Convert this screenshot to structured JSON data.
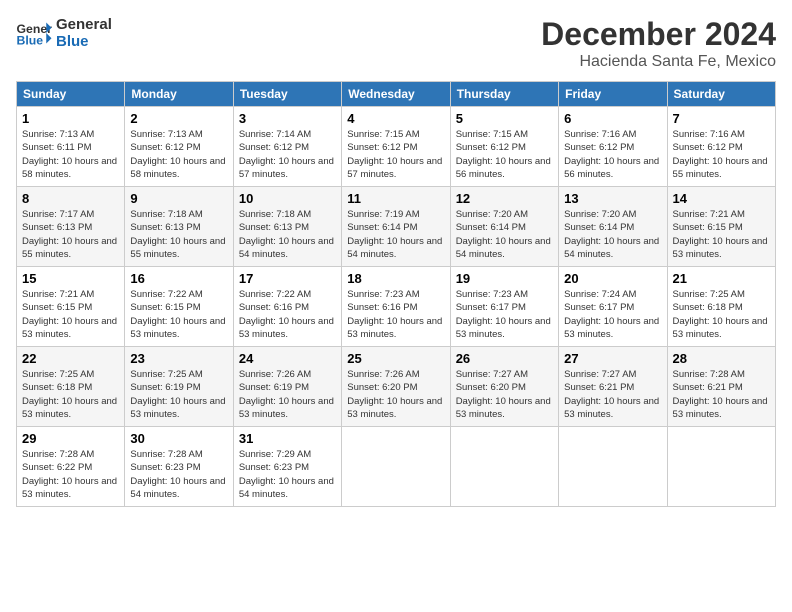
{
  "logo": {
    "line1": "General",
    "line2": "Blue"
  },
  "title": "December 2024",
  "location": "Hacienda Santa Fe, Mexico",
  "days_of_week": [
    "Sunday",
    "Monday",
    "Tuesday",
    "Wednesday",
    "Thursday",
    "Friday",
    "Saturday"
  ],
  "weeks": [
    [
      {
        "day": "1",
        "sunrise": "7:13 AM",
        "sunset": "6:11 PM",
        "daylight": "10 hours and 58 minutes."
      },
      {
        "day": "2",
        "sunrise": "7:13 AM",
        "sunset": "6:12 PM",
        "daylight": "10 hours and 58 minutes."
      },
      {
        "day": "3",
        "sunrise": "7:14 AM",
        "sunset": "6:12 PM",
        "daylight": "10 hours and 57 minutes."
      },
      {
        "day": "4",
        "sunrise": "7:15 AM",
        "sunset": "6:12 PM",
        "daylight": "10 hours and 57 minutes."
      },
      {
        "day": "5",
        "sunrise": "7:15 AM",
        "sunset": "6:12 PM",
        "daylight": "10 hours and 56 minutes."
      },
      {
        "day": "6",
        "sunrise": "7:16 AM",
        "sunset": "6:12 PM",
        "daylight": "10 hours and 56 minutes."
      },
      {
        "day": "7",
        "sunrise": "7:16 AM",
        "sunset": "6:12 PM",
        "daylight": "10 hours and 55 minutes."
      }
    ],
    [
      {
        "day": "8",
        "sunrise": "7:17 AM",
        "sunset": "6:13 PM",
        "daylight": "10 hours and 55 minutes."
      },
      {
        "day": "9",
        "sunrise": "7:18 AM",
        "sunset": "6:13 PM",
        "daylight": "10 hours and 55 minutes."
      },
      {
        "day": "10",
        "sunrise": "7:18 AM",
        "sunset": "6:13 PM",
        "daylight": "10 hours and 54 minutes."
      },
      {
        "day": "11",
        "sunrise": "7:19 AM",
        "sunset": "6:14 PM",
        "daylight": "10 hours and 54 minutes."
      },
      {
        "day": "12",
        "sunrise": "7:20 AM",
        "sunset": "6:14 PM",
        "daylight": "10 hours and 54 minutes."
      },
      {
        "day": "13",
        "sunrise": "7:20 AM",
        "sunset": "6:14 PM",
        "daylight": "10 hours and 54 minutes."
      },
      {
        "day": "14",
        "sunrise": "7:21 AM",
        "sunset": "6:15 PM",
        "daylight": "10 hours and 53 minutes."
      }
    ],
    [
      {
        "day": "15",
        "sunrise": "7:21 AM",
        "sunset": "6:15 PM",
        "daylight": "10 hours and 53 minutes."
      },
      {
        "day": "16",
        "sunrise": "7:22 AM",
        "sunset": "6:15 PM",
        "daylight": "10 hours and 53 minutes."
      },
      {
        "day": "17",
        "sunrise": "7:22 AM",
        "sunset": "6:16 PM",
        "daylight": "10 hours and 53 minutes."
      },
      {
        "day": "18",
        "sunrise": "7:23 AM",
        "sunset": "6:16 PM",
        "daylight": "10 hours and 53 minutes."
      },
      {
        "day": "19",
        "sunrise": "7:23 AM",
        "sunset": "6:17 PM",
        "daylight": "10 hours and 53 minutes."
      },
      {
        "day": "20",
        "sunrise": "7:24 AM",
        "sunset": "6:17 PM",
        "daylight": "10 hours and 53 minutes."
      },
      {
        "day": "21",
        "sunrise": "7:25 AM",
        "sunset": "6:18 PM",
        "daylight": "10 hours and 53 minutes."
      }
    ],
    [
      {
        "day": "22",
        "sunrise": "7:25 AM",
        "sunset": "6:18 PM",
        "daylight": "10 hours and 53 minutes."
      },
      {
        "day": "23",
        "sunrise": "7:25 AM",
        "sunset": "6:19 PM",
        "daylight": "10 hours and 53 minutes."
      },
      {
        "day": "24",
        "sunrise": "7:26 AM",
        "sunset": "6:19 PM",
        "daylight": "10 hours and 53 minutes."
      },
      {
        "day": "25",
        "sunrise": "7:26 AM",
        "sunset": "6:20 PM",
        "daylight": "10 hours and 53 minutes."
      },
      {
        "day": "26",
        "sunrise": "7:27 AM",
        "sunset": "6:20 PM",
        "daylight": "10 hours and 53 minutes."
      },
      {
        "day": "27",
        "sunrise": "7:27 AM",
        "sunset": "6:21 PM",
        "daylight": "10 hours and 53 minutes."
      },
      {
        "day": "28",
        "sunrise": "7:28 AM",
        "sunset": "6:21 PM",
        "daylight": "10 hours and 53 minutes."
      }
    ],
    [
      {
        "day": "29",
        "sunrise": "7:28 AM",
        "sunset": "6:22 PM",
        "daylight": "10 hours and 53 minutes."
      },
      {
        "day": "30",
        "sunrise": "7:28 AM",
        "sunset": "6:23 PM",
        "daylight": "10 hours and 54 minutes."
      },
      {
        "day": "31",
        "sunrise": "7:29 AM",
        "sunset": "6:23 PM",
        "daylight": "10 hours and 54 minutes."
      },
      null,
      null,
      null,
      null
    ]
  ],
  "labels": {
    "sunrise_prefix": "Sunrise: ",
    "sunset_prefix": "Sunset: ",
    "daylight_prefix": "Daylight: "
  }
}
